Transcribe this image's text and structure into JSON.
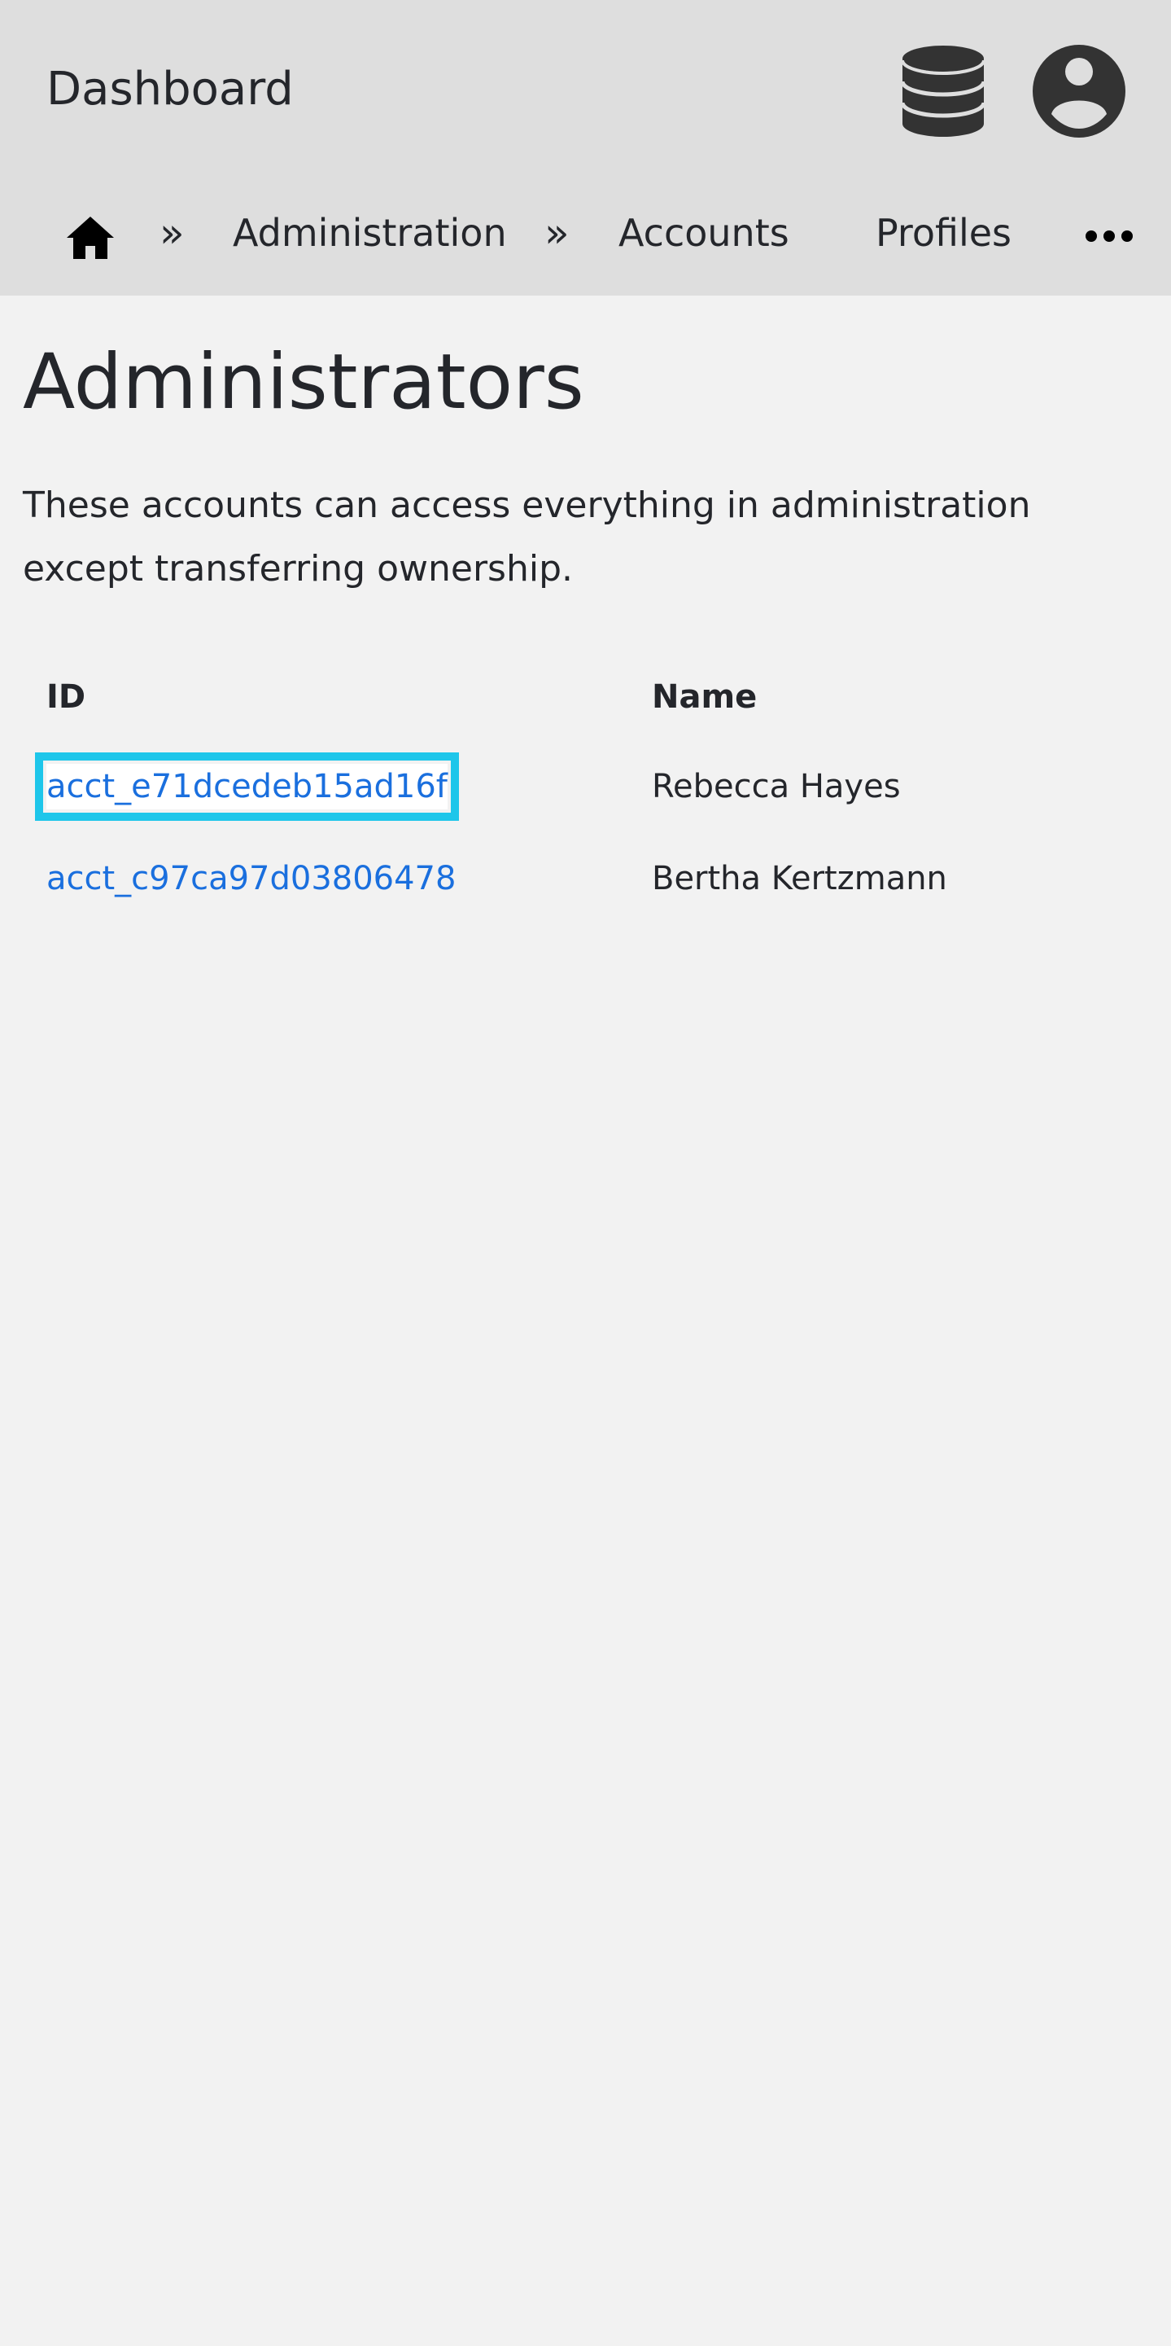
{
  "header": {
    "title": "Dashboard",
    "icons": [
      "database-icon",
      "user-account-icon"
    ]
  },
  "breadcrumb": {
    "home_icon": "home-icon",
    "separator": "»",
    "items": [
      {
        "label": "Administration"
      },
      {
        "label": "Accounts"
      },
      {
        "label": "Profiles"
      }
    ],
    "more_icon": "more-horizontal-icon"
  },
  "page": {
    "title": "Administrators",
    "description": "These accounts can access everything in administration except transferring ownership."
  },
  "table": {
    "columns": [
      "ID",
      "Name"
    ],
    "rows": [
      {
        "id": "acct_e71dcedeb15ad16f",
        "name": "Rebecca Hayes",
        "focused": true
      },
      {
        "id": "acct_c97ca97d03806478",
        "name": "Bertha Kertzmann",
        "focused": false
      }
    ]
  },
  "colors": {
    "header_bg": "#dedede",
    "page_bg": "#f2f2f2",
    "link": "#1a6fde",
    "focus_ring": "#1ec6ea",
    "text": "#24262b",
    "icon": "#333333"
  }
}
